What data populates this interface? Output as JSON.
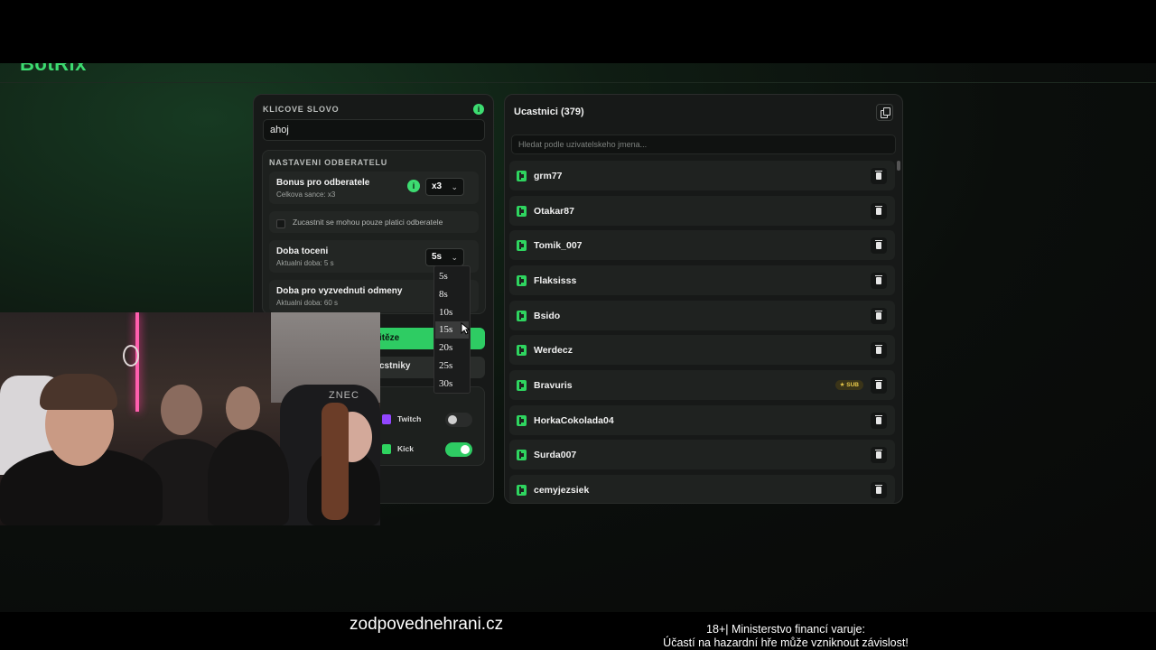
{
  "brand": "BotRix",
  "keyword": {
    "label": "KLICOVE SLOVO",
    "value": "ahoj",
    "info_icon": "info-icon"
  },
  "subscribers": {
    "title": "NASTAVENI ODBERATELU",
    "bonus": {
      "title": "Bonus pro odberatele",
      "subtitle": "Celkova sance: x3",
      "value": "x3"
    },
    "paid_only": {
      "label": "Zucastnit se mohou pouze platici odberatele",
      "checked": false
    },
    "spin": {
      "title": "Doba toceni",
      "subtitle": "Aktualni doba: 5 s",
      "value": "5s"
    },
    "claim": {
      "title": "Doba pro vyzvednuti odmeny",
      "subtitle": "Aktualni doba: 60 s"
    }
  },
  "spin_dropdown": {
    "options": [
      "5s",
      "8s",
      "10s",
      "15s",
      "20s",
      "25s",
      "30s"
    ],
    "highlighted": "15s"
  },
  "actions": {
    "primary_label": "itěze",
    "secondary_label": "cstniky"
  },
  "platforms": [
    {
      "name": "Twitch",
      "enabled": false,
      "color": "#9146ff"
    },
    {
      "name": "Kick",
      "enabled": true,
      "color": "#2ed45f"
    }
  ],
  "participants": {
    "title": "Ucastnici (379)",
    "search_placeholder": "Hledat podle uzivatelskeho jmena...",
    "items": [
      {
        "name": "grm77",
        "badge": ""
      },
      {
        "name": "Otakar87",
        "badge": ""
      },
      {
        "name": "Tomik_007",
        "badge": ""
      },
      {
        "name": "Flaksisss",
        "badge": ""
      },
      {
        "name": "Bsido",
        "badge": ""
      },
      {
        "name": "Werdecz",
        "badge": ""
      },
      {
        "name": "Bravuris",
        "badge": "★ SUB"
      },
      {
        "name": "HorkaCokolada04",
        "badge": ""
      },
      {
        "name": "Surda007",
        "badge": ""
      },
      {
        "name": "cemyjezsiek",
        "badge": ""
      }
    ]
  },
  "webcam": {
    "chair_text": "ZNEC"
  },
  "footer": {
    "left": "zodpovednehrani.cz",
    "right_line1": "18+| Ministerstvo financí varuje:",
    "right_line2": "Účastí na hazardní hře může vzniknout závislost!"
  },
  "colors": {
    "accent": "#3ddc71",
    "background": "#0b0e0c",
    "panel": "#171918"
  }
}
